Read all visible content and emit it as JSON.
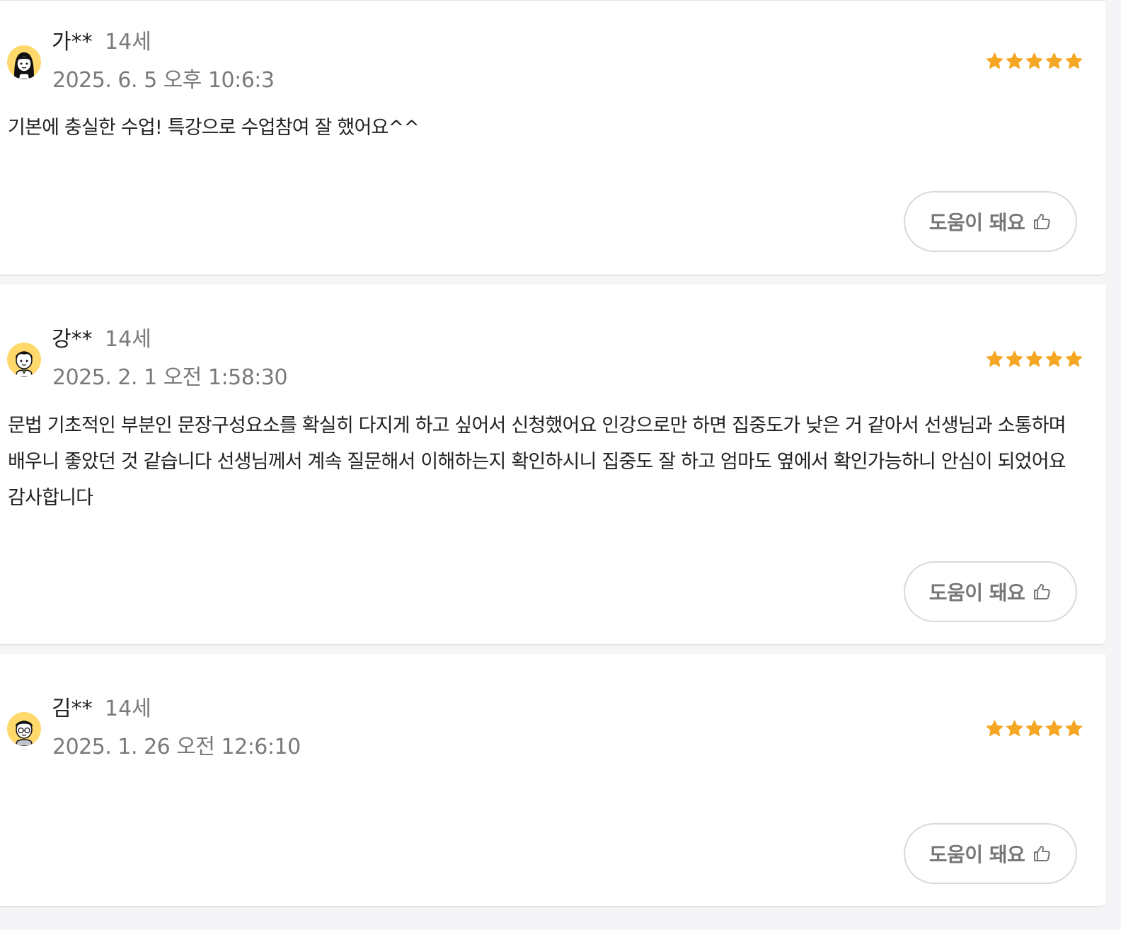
{
  "reviews": [
    {
      "name": "가**",
      "age": "14세",
      "date": "2025. 6. 5 오후 10:6:3",
      "rating": 5,
      "text": "기본에 충실한 수업! 특강으로 수업참여 잘 했어요^^",
      "avatar": "girl-avatar-icon",
      "helpful_label": "도움이 돼요"
    },
    {
      "name": "강**",
      "age": "14세",
      "date": "2025. 2. 1 오전 1:58:30",
      "rating": 5,
      "text": "문법 기초적인 부분인 문장구성요소를 확실히 다지게 하고 싶어서 신청했어요 인강으로만 하면 집중도가 낮은 거 같아서 선생님과 소통하며 배우니 좋았던 것 같습니다 선생님께서 계속 질문해서 이해하는지 확인하시니 집중도 잘 하고 엄마도 옆에서 확인가능하니 안심이 되었어요 감사합니다",
      "avatar": "boy-avatar-icon",
      "helpful_label": "도움이 돼요"
    },
    {
      "name": "김**",
      "age": "14세",
      "date": "2025. 1. 26 오전 12:6:10",
      "rating": 5,
      "text": "",
      "avatar": "boy-glasses-avatar-icon",
      "helpful_label": "도움이 돼요"
    }
  ],
  "colors": {
    "star": "#f5a623",
    "avatar_bg": "#ffd96b",
    "muted_text": "#7a7a7a",
    "border": "#d9d9dc"
  }
}
